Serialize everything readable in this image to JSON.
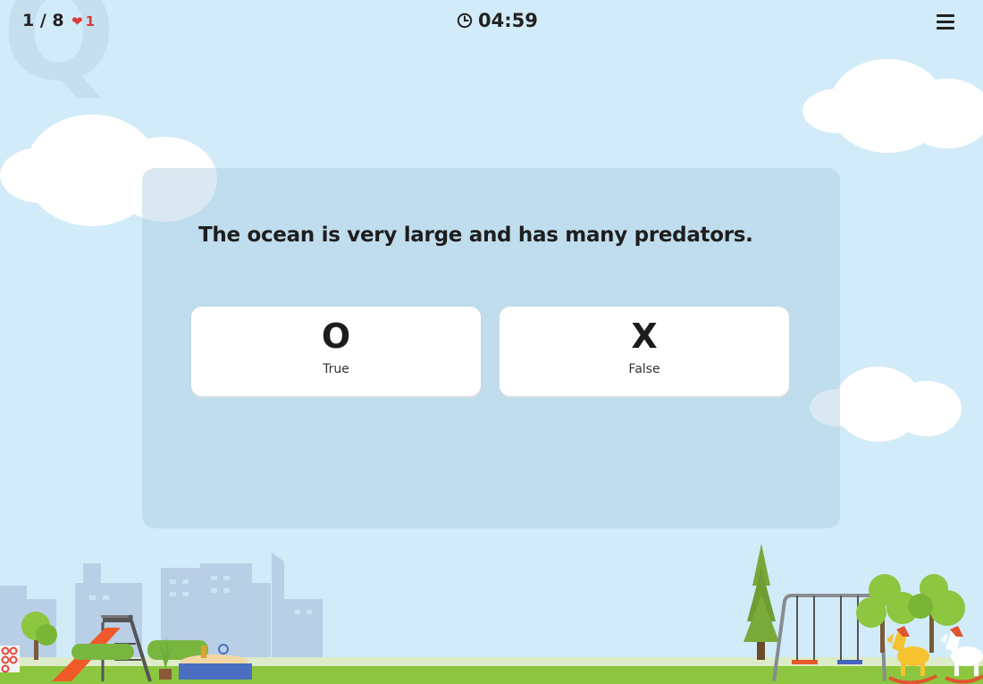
{
  "header": {
    "progress": "1 / 8",
    "lives": "1",
    "timer": "04:59",
    "watermark": "Q"
  },
  "question": {
    "text": "The ocean is very large and has many predators."
  },
  "answers": [
    {
      "symbol": "O",
      "label": "True"
    },
    {
      "symbol": "X",
      "label": "False"
    }
  ],
  "colors": {
    "sky": "#d2ebf9",
    "heart": "#d93a3a",
    "grass": "#8cc63e",
    "buildings": "#b7cde4"
  },
  "icons": {
    "timer": "clock-icon",
    "menu": "hamburger-menu-icon",
    "lives": "heart-icon"
  }
}
